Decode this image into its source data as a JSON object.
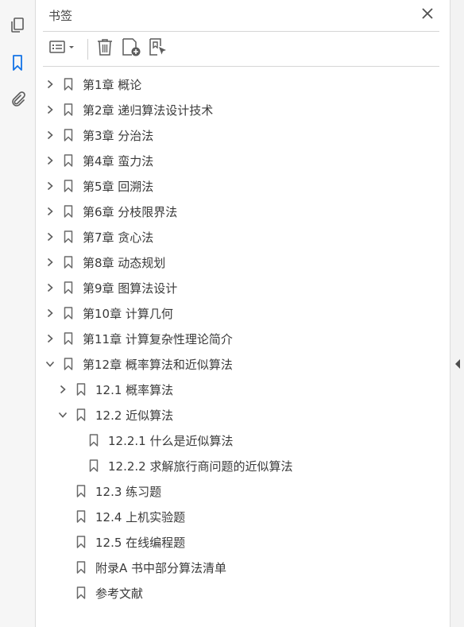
{
  "panel": {
    "title": "书签"
  },
  "sidebar_icons": [
    {
      "name": "pages-thumbnail-icon"
    },
    {
      "name": "bookmark-icon",
      "active": true
    },
    {
      "name": "attachment-icon"
    }
  ],
  "toolbar_icons": [
    "options-menu-icon",
    "delete-bookmark-icon",
    "new-bookmark-icon",
    "bookmark-from-selection-icon"
  ],
  "bookmarks": [
    {
      "label": "第1章 概论",
      "level": 0,
      "toggle": "collapsed"
    },
    {
      "label": "第2章 递归算法设计技术",
      "level": 0,
      "toggle": "collapsed"
    },
    {
      "label": "第3章 分治法",
      "level": 0,
      "toggle": "collapsed"
    },
    {
      "label": "第4章 蛮力法",
      "level": 0,
      "toggle": "collapsed"
    },
    {
      "label": "第5章 回溯法",
      "level": 0,
      "toggle": "collapsed"
    },
    {
      "label": "第6章 分枝限界法",
      "level": 0,
      "toggle": "collapsed"
    },
    {
      "label": "第7章 贪心法",
      "level": 0,
      "toggle": "collapsed"
    },
    {
      "label": "第8章 动态规划",
      "level": 0,
      "toggle": "collapsed"
    },
    {
      "label": "第9章 图算法设计",
      "level": 0,
      "toggle": "collapsed"
    },
    {
      "label": "第10章 计算几何",
      "level": 0,
      "toggle": "collapsed"
    },
    {
      "label": "第11章 计算复杂性理论简介",
      "level": 0,
      "toggle": "collapsed"
    },
    {
      "label": "第12章 概率算法和近似算法",
      "level": 0,
      "toggle": "expanded"
    },
    {
      "label": "12.1 概率算法",
      "level": 1,
      "toggle": "collapsed"
    },
    {
      "label": "12.2 近似算法",
      "level": 1,
      "toggle": "expanded"
    },
    {
      "label": "12.2.1 什么是近似算法",
      "level": 2,
      "toggle": "none"
    },
    {
      "label": "12.2.2 求解旅行商问题的近似算法",
      "level": 2,
      "toggle": "none"
    },
    {
      "label": "12.3 练习题",
      "level": 1,
      "toggle": "none"
    },
    {
      "label": "12.4 上机实验题",
      "level": 1,
      "toggle": "none"
    },
    {
      "label": "12.5 在线编程题",
      "level": 1,
      "toggle": "none"
    },
    {
      "label": "附录A  书中部分算法清单",
      "level": 1,
      "toggle": "none"
    },
    {
      "label": "参考文献",
      "level": 1,
      "toggle": "none"
    }
  ],
  "colors": {
    "accent": "#1473e6",
    "icon": "#5c5c5c",
    "text": "#3a3a3a"
  }
}
